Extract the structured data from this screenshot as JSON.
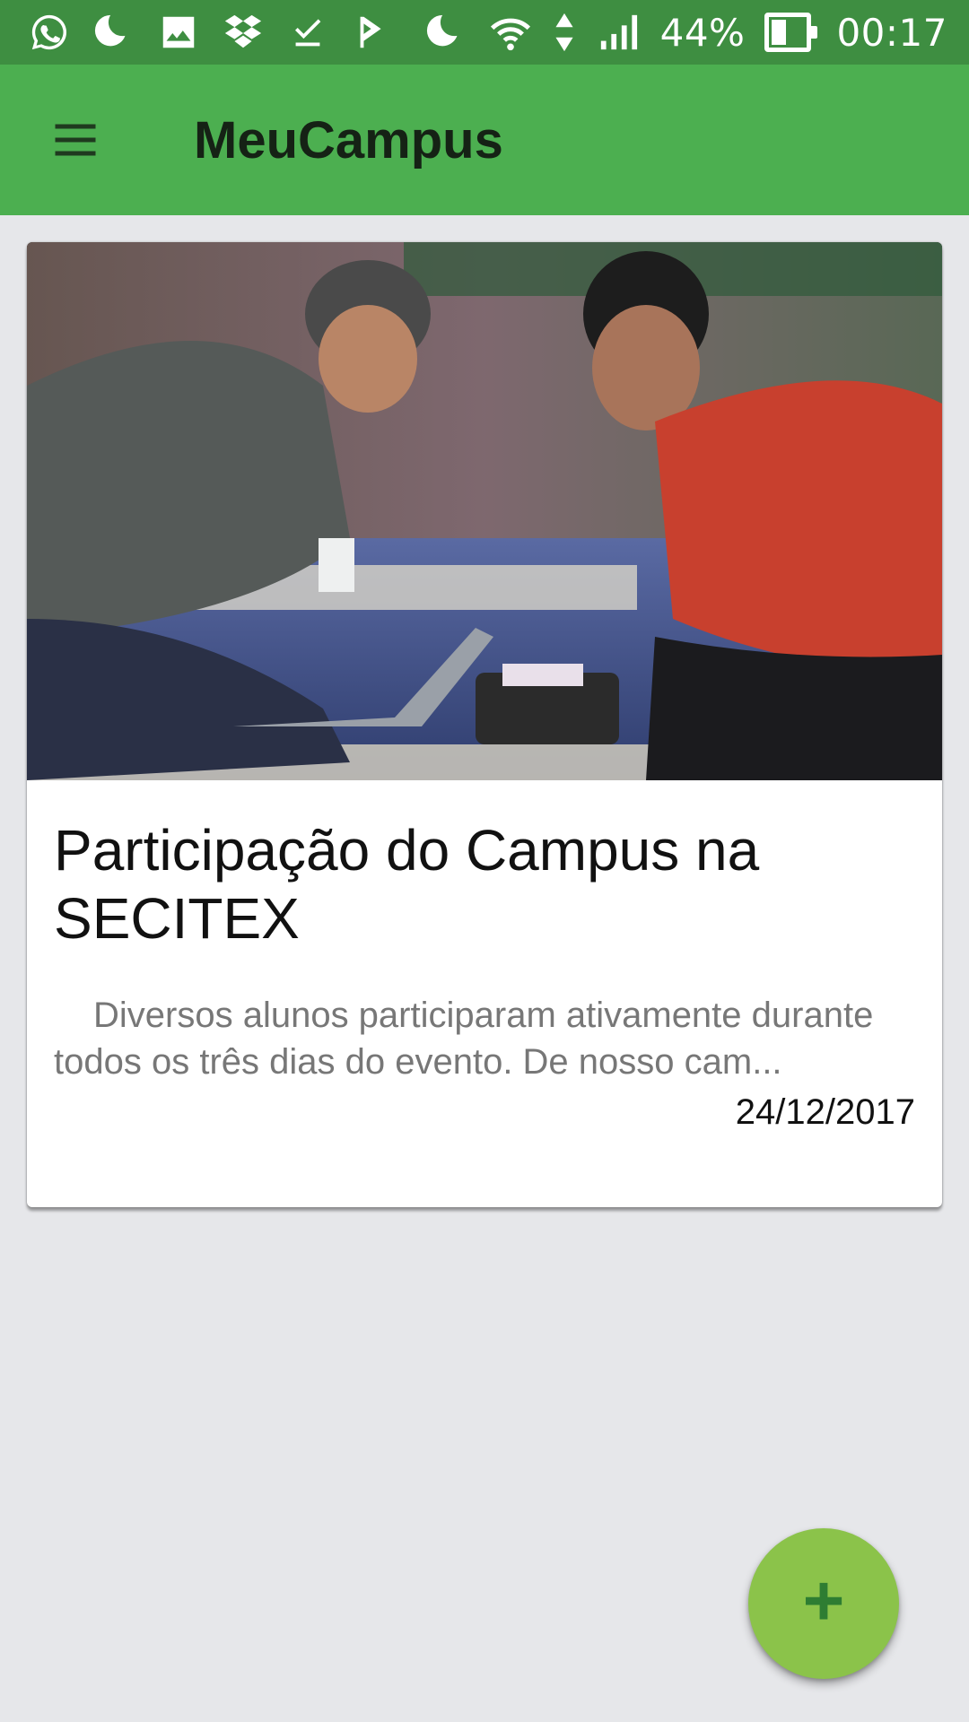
{
  "status_bar": {
    "battery_percent": "44%",
    "battery_level": 0.44,
    "time": "00:17",
    "left_icons": [
      "whatsapp-icon",
      "moon-icon",
      "image-icon",
      "dropbox-icon",
      "download-done-icon",
      "check-flag-icon"
    ],
    "right_icons": [
      "moon-icon",
      "wifi-icon",
      "data-arrows-icon",
      "signal-icon",
      "battery-icon"
    ]
  },
  "app_bar": {
    "title": "MeuCampus",
    "menu_icon": "hamburger-icon",
    "background": "#4caf50"
  },
  "feed": {
    "items": [
      {
        "title": "Participação do Campus na SECITEX",
        "excerpt": "Diversos alunos participaram ativamente durante todos os três dias do evento. De nosso cam...",
        "date": "24/12/2017",
        "image_alt": "photo"
      }
    ]
  },
  "fab": {
    "label": "+",
    "icon": "add-icon",
    "color": "#8bc34a"
  }
}
